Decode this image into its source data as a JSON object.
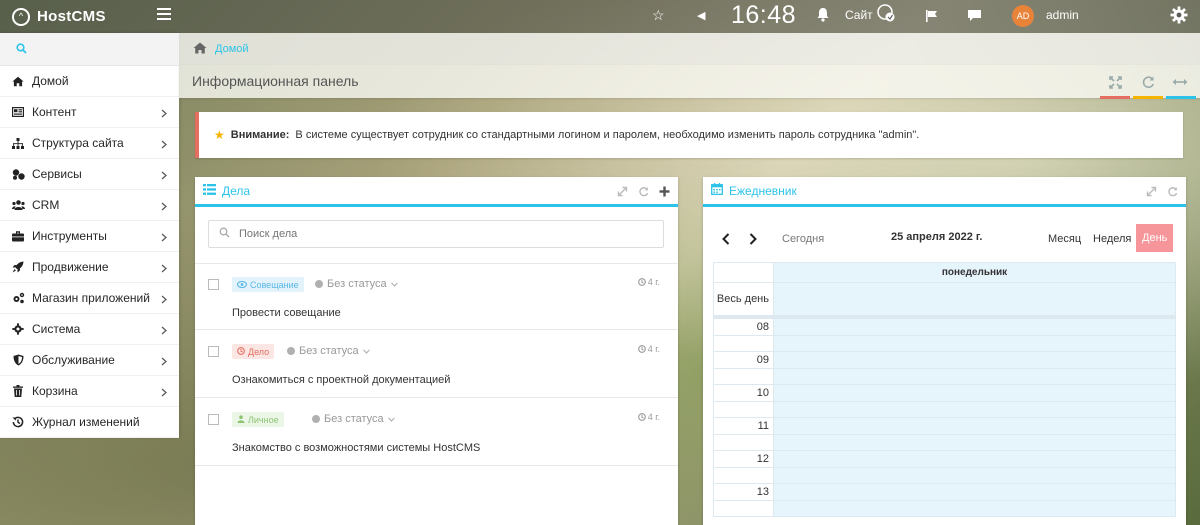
{
  "topbar": {
    "logo_text": "HostCMS",
    "clock": "16:48",
    "site_label": "Сайт",
    "avatar_initials": "AD",
    "username": "admin"
  },
  "sidebar": {
    "items": [
      {
        "label": "Домой",
        "icon": "home-icon",
        "has_submenu": false
      },
      {
        "label": "Контент",
        "icon": "content-icon",
        "has_submenu": true
      },
      {
        "label": "Структура сайта",
        "icon": "sitemap-icon",
        "has_submenu": true
      },
      {
        "label": "Сервисы",
        "icon": "services-icon",
        "has_submenu": true
      },
      {
        "label": "CRM",
        "icon": "users-icon",
        "has_submenu": true
      },
      {
        "label": "Инструменты",
        "icon": "briefcase-icon",
        "has_submenu": true
      },
      {
        "label": "Продвижение",
        "icon": "rocket-icon",
        "has_submenu": true
      },
      {
        "label": "Магазин приложений",
        "icon": "cogs-icon",
        "has_submenu": true
      },
      {
        "label": "Система",
        "icon": "gear-icon",
        "has_submenu": true
      },
      {
        "label": "Обслуживание",
        "icon": "shield-icon",
        "has_submenu": true
      },
      {
        "label": "Корзина",
        "icon": "trash-icon",
        "has_submenu": true
      },
      {
        "label": "Журнал изменений",
        "icon": "history-icon",
        "has_submenu": false
      }
    ]
  },
  "breadcrumb": {
    "home_label": "Домой"
  },
  "page": {
    "title": "Информационная панель"
  },
  "colors": {
    "accent": "#2dc3e8",
    "alert_border": "#e46f61",
    "day_active": "#f7969a",
    "line_red": "#e46f61",
    "line_yellow": "#f4b400",
    "line_blue": "#2dc3e8"
  },
  "alert": {
    "prefix": "Внимание:",
    "text": "В системе существует сотрудник со стандартными логином и паролем, необходимо изменить пароль сотрудника \"admin\"."
  },
  "tasks_widget": {
    "title": "Дела",
    "search_placeholder": "Поиск дела",
    "tasks": [
      {
        "type": "Совещание",
        "type_color": "#5bb7e5",
        "type_bg": "#e3f3fb",
        "status": "Без статуса",
        "age": "4 г.",
        "title": "Провести совещание"
      },
      {
        "type": "Дело",
        "type_color": "#e46f61",
        "type_bg": "#fbe6e3",
        "status": "Без статуса",
        "age": "4 г.",
        "title": "Ознакомиться с проектной документацией"
      },
      {
        "type": "Личное",
        "type_color": "#8cc474",
        "type_bg": "#ecf6e7",
        "status": "Без статуса",
        "age": "4 г.",
        "title": "Знакомство с возможностями системы HostCMS"
      }
    ]
  },
  "calendar_widget": {
    "title": "Ежедневник",
    "today_label": "Сегодня",
    "date_label": "25 апреля 2022 г.",
    "views": {
      "month": "Месяц",
      "week": "Неделя",
      "day": "День"
    },
    "day_column": "понедельник",
    "all_day_label": "Весь день",
    "hours": [
      "08",
      "09",
      "10",
      "11",
      "12",
      "13"
    ]
  }
}
